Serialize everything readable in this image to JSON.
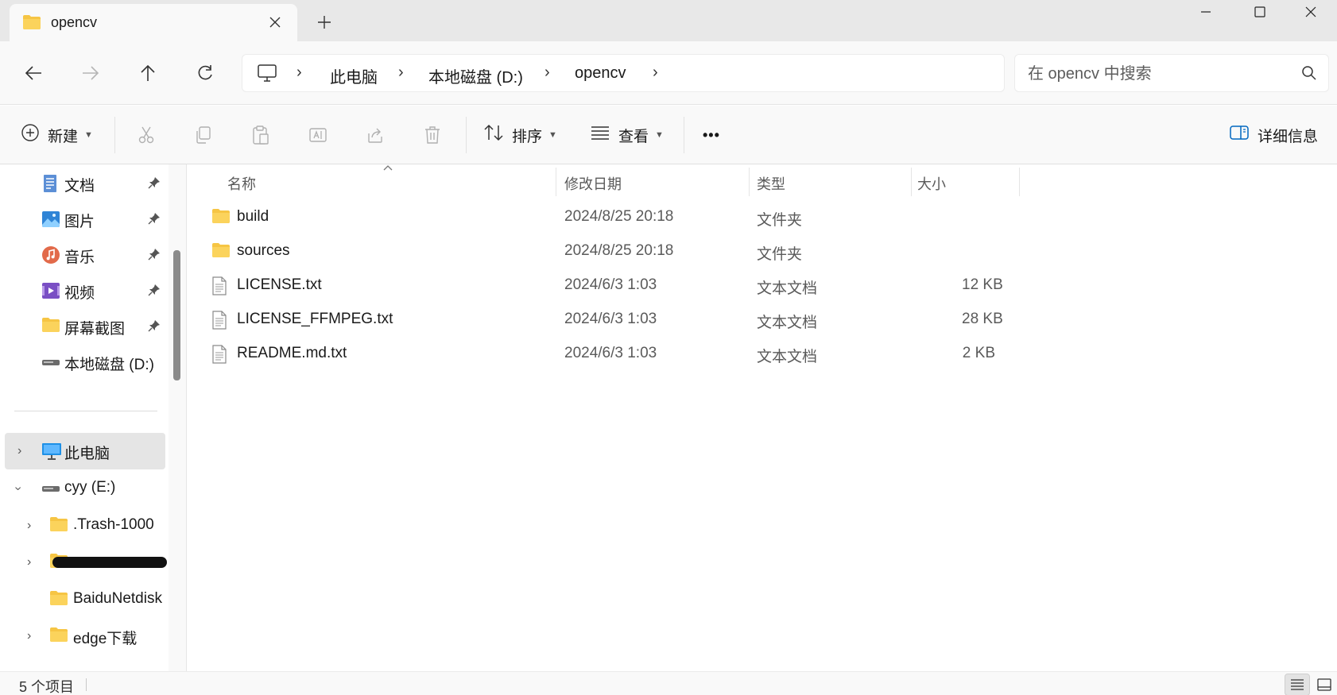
{
  "tab": {
    "title": "opencv",
    "icon": "folder-icon"
  },
  "address": {
    "crumbs": [
      "此电脑",
      "本地磁盘 (D:)",
      "opencv"
    ]
  },
  "search": {
    "placeholder": "在 opencv 中搜索"
  },
  "toolbar": {
    "new_label": "新建",
    "sort_label": "排序",
    "view_label": "查看",
    "more_label": "•••",
    "details_label": "详细信息"
  },
  "sidebar": {
    "pinned": [
      {
        "label": "文档",
        "icon": "documents-icon"
      },
      {
        "label": "图片",
        "icon": "pictures-icon"
      },
      {
        "label": "音乐",
        "icon": "music-icon"
      },
      {
        "label": "视频",
        "icon": "videos-icon"
      },
      {
        "label": "屏幕截图",
        "icon": "folder-icon"
      },
      {
        "label": "本地磁盘 (D:)",
        "icon": "drive-icon"
      }
    ],
    "tree": [
      {
        "label": "此电脑",
        "icon": "computer-icon",
        "selected": true
      },
      {
        "label": "cyy (E:)",
        "icon": "drive-icon",
        "expanded": true
      },
      {
        "label": ".Trash-1000",
        "icon": "folder-icon"
      },
      {
        "label": "",
        "icon": "folder-icon",
        "redacted": true
      },
      {
        "label": "BaiduNetdisk",
        "icon": "folder-icon"
      },
      {
        "label": "edge下载",
        "icon": "folder-icon"
      }
    ]
  },
  "columns": {
    "name": "名称",
    "date": "修改日期",
    "type": "类型",
    "size": "大小"
  },
  "files": [
    {
      "name": "build",
      "date": "2024/8/25 20:18",
      "type": "文件夹",
      "size": "",
      "icon": "folder-icon"
    },
    {
      "name": "sources",
      "date": "2024/8/25 20:18",
      "type": "文件夹",
      "size": "",
      "icon": "folder-icon"
    },
    {
      "name": "LICENSE.txt",
      "date": "2024/6/3 1:03",
      "type": "文本文档",
      "size": "12 KB",
      "icon": "text-file-icon"
    },
    {
      "name": "LICENSE_FFMPEG.txt",
      "date": "2024/6/3 1:03",
      "type": "文本文档",
      "size": "28 KB",
      "icon": "text-file-icon"
    },
    {
      "name": "README.md.txt",
      "date": "2024/6/3 1:03",
      "type": "文本文档",
      "size": "2 KB",
      "icon": "text-file-icon"
    }
  ],
  "status": {
    "count": "5 个项目"
  },
  "colors": {
    "folder": "#f6c544",
    "folder_dark": "#e3a82b",
    "selection": "#e5e5e5",
    "accent": "#0067c0"
  }
}
